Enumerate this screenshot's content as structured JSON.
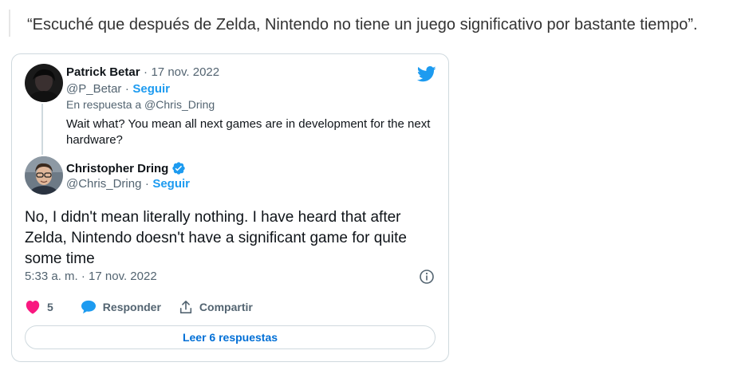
{
  "quote_text": "“Escuché que después de Zelda, Nintendo no tiene un juego significativo por bastante tiempo”.",
  "parent_tweet": {
    "author_name": "Patrick Betar",
    "separator": "·",
    "date": "17 nov. 2022",
    "handle": "@P_Betar",
    "follow_label": "Seguir",
    "reply_to": "En respuesta a @Chris_Dring",
    "text": "Wait what? You mean all next games are in development for the next hardware?"
  },
  "main_tweet": {
    "author_name": "Christopher Dring",
    "handle": "@Chris_Dring",
    "separator": "·",
    "follow_label": "Seguir",
    "text": "No, I didn't mean literally nothing. I have heard that after Zelda, Nintendo doesn't have a significant game for quite some time",
    "timestamp": "5:33 a. m. · 17 nov. 2022",
    "likes": "5",
    "reply_label": "Responder",
    "share_label": "Compartir",
    "read_replies_label": "Leer 6 respuestas"
  },
  "colors": {
    "twitter_blue": "#1d9bf0",
    "heart_red": "#f91880",
    "link_blue": "#006fd6",
    "muted": "#536471"
  },
  "icons": [
    "twitter-bird-icon",
    "verified-badge-icon",
    "info-icon",
    "heart-icon",
    "reply-bubble-icon",
    "share-icon"
  ]
}
